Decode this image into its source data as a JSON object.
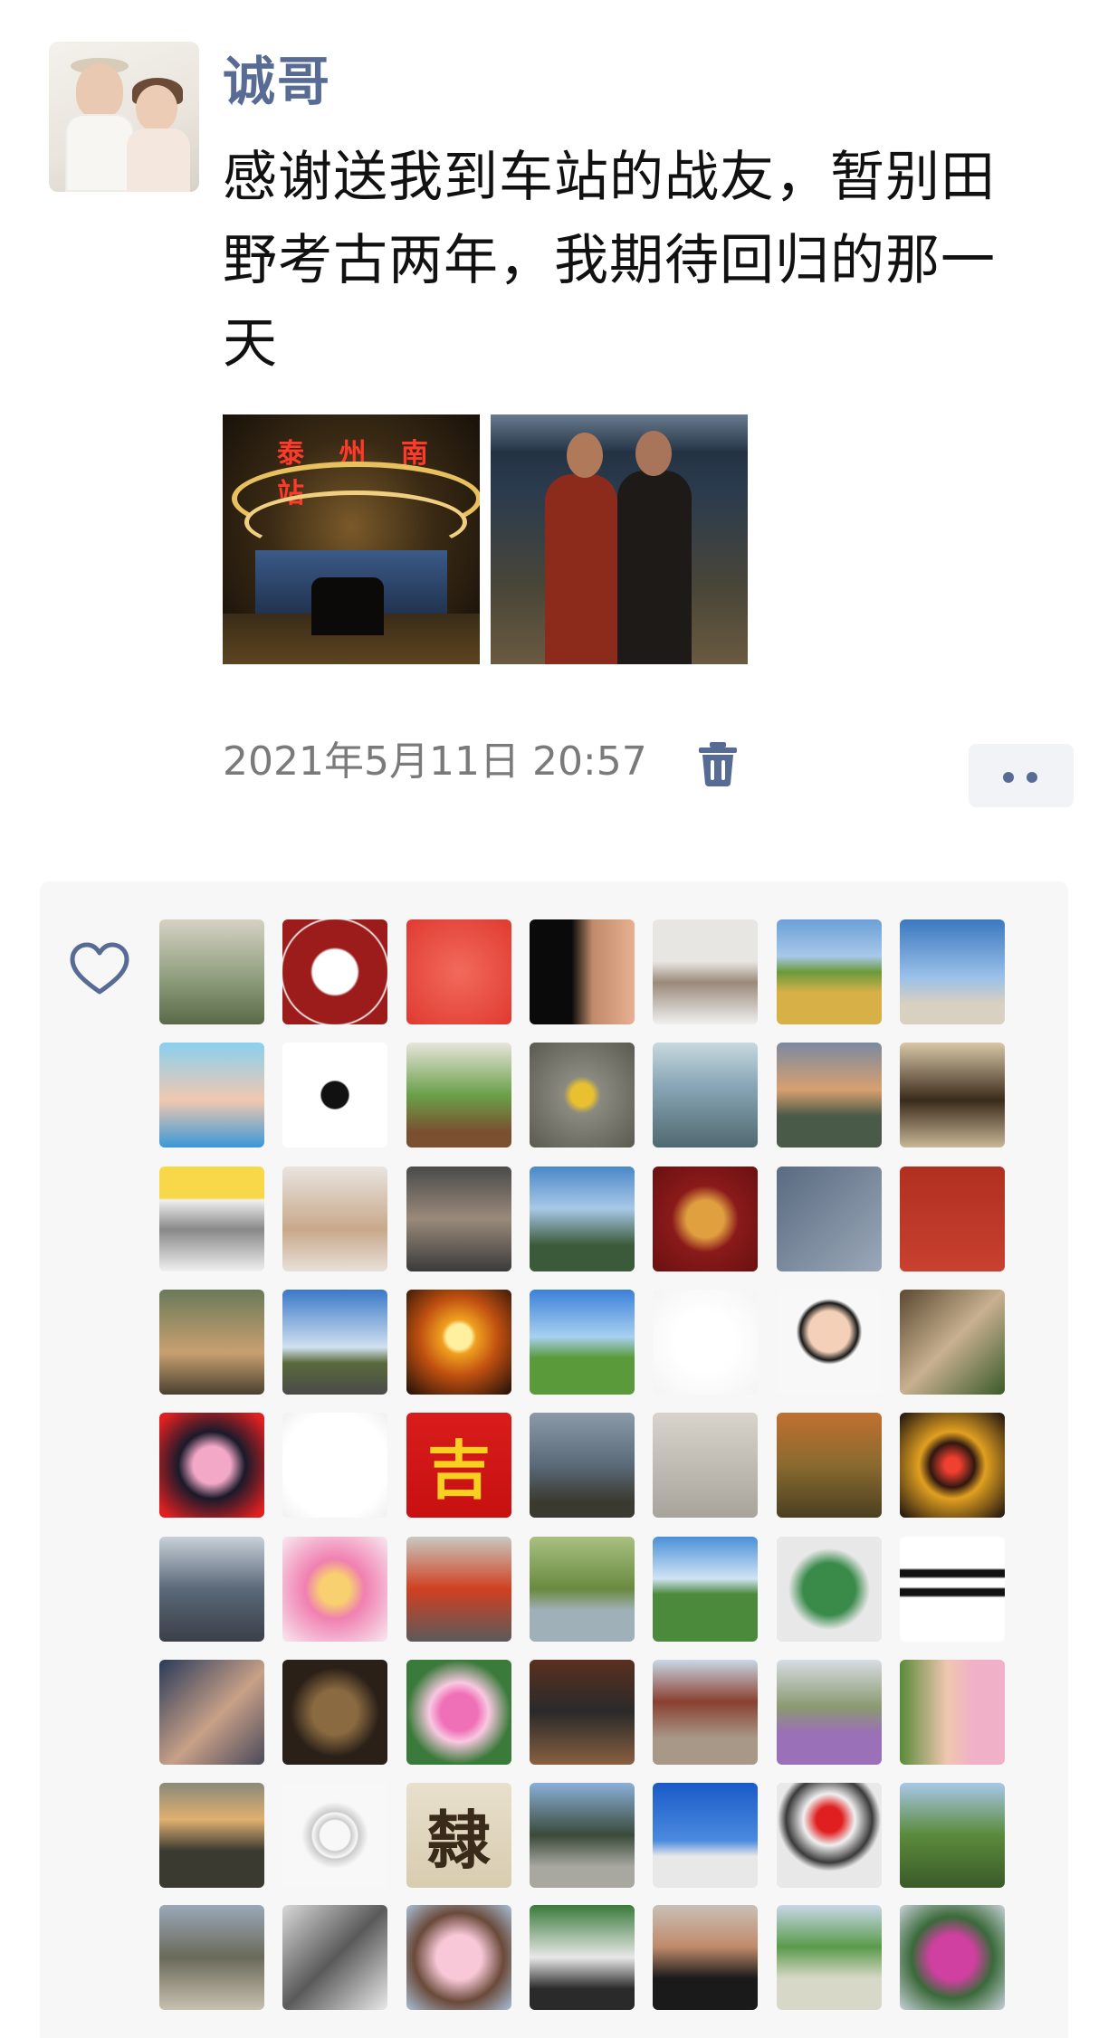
{
  "post": {
    "username": "诚哥",
    "text": "感谢送我到车站的战友，暂别田野考古两年，我期待回归的那一天",
    "photo1_sign": "泰 州 南 站",
    "timestamp": "2021年5月11日 20:57"
  },
  "likes": {
    "avatars": [
      {
        "name": "landscape-painting",
        "bg": "linear-gradient(180deg,#d6d2c4,#8a9a78 60%,#5a6a4a)"
      },
      {
        "name": "peking-university-logo",
        "bg": "radial-gradient(circle,#ffffff 30%,#9c1c1c 33%,#9c1c1c 70%,#ffffff 72%,#9c1c1c 74%)"
      },
      {
        "name": "red-square",
        "bg": "radial-gradient(circle,#f26a5c,#e03a30)"
      },
      {
        "name": "baby-photo",
        "bg": "linear-gradient(90deg,#0a0a0a 40%,#c08a6a 60%,#e8b090)"
      },
      {
        "name": "man-portrait",
        "bg": "linear-gradient(180deg,#e8e6e2 40%,#9a8a7a 60%,#f0f0f0)"
      },
      {
        "name": "wheat-field",
        "bg": "linear-gradient(180deg,#6aa0d8 0%,#a8c8e8 35%,#6a9a3a 50%,#d8b048 70%)"
      },
      {
        "name": "beach-person",
        "bg": "linear-gradient(180deg,#3a78c0 0%,#9ac0e8 55%,#d8d0c0 80%)"
      },
      {
        "name": "girl-camera",
        "bg": "linear-gradient(180deg,#8ad0f0,#f0c8b0 55%,#3a98d8)"
      },
      {
        "name": "jumpman-logo",
        "bg": "radial-gradient(circle at 50% 50%,#111 18%,#fff 20%)"
      },
      {
        "name": "bamboo-plant",
        "bg": "linear-gradient(180deg,#e8e4dc,#6aa048 50%,#7a5030 85%)"
      },
      {
        "name": "leaf-heart",
        "bg": "radial-gradient(circle,#e8c030 15%,#8a8a80 25%,#5a5a50)"
      },
      {
        "name": "lake-ducks",
        "bg": "linear-gradient(180deg,#c8d8e0,#8aa8b8 40%,#506870)"
      },
      {
        "name": "sunset-hills",
        "bg": "linear-gradient(180deg,#7a8aa0,#d8a070 45%,#4a5a48 70%)"
      },
      {
        "name": "bronze-vessel",
        "bg": "linear-gradient(180deg,#d8c8a8,#3a2a1a 55%,#c8b898)"
      },
      {
        "name": "cat-cartoon",
        "bg": "linear-gradient(180deg,#f8d848 30%,#f0f0f0 32%,#888 60%,#f0f0f0)"
      },
      {
        "name": "toddler-photo",
        "bg": "linear-gradient(180deg,#e8e4e0,#c8a88a 60%,#e8e0d8)"
      },
      {
        "name": "baby-sofa",
        "bg": "linear-gradient(180deg,#4a4a4a,#9a8a7a 50%,#3a3a3a)"
      },
      {
        "name": "mountain-sky",
        "bg": "linear-gradient(180deg,#4a88c8,#a8c8e8 40%,#3a5a3a 75%)"
      },
      {
        "name": "crest-emblem",
        "bg": "radial-gradient(circle,#e0a040 25%,#8a1a1a 45%,#6a1010)"
      },
      {
        "name": "praying-hands",
        "bg": "linear-gradient(135deg,#5a6a80,#9aa8b8)"
      },
      {
        "name": "calligraphy-seal",
        "bg": "linear-gradient(180deg,#b03020,#c84030)"
      },
      {
        "name": "kitten-photo",
        "bg": "linear-gradient(180deg,#6a7a5a,#c8a070 60%,#4a4030)"
      },
      {
        "name": "road-sky",
        "bg": "linear-gradient(180deg,#3a78c8,#d0e0f0 55%,#5a6a3a 70%,#4a4a4a)"
      },
      {
        "name": "sunset-sun",
        "bg": "radial-gradient(circle at 50% 45%,#fff0a0 16%,#f0a020 22%,#c05010 50%,#201008)"
      },
      {
        "name": "horse-rider",
        "bg": "linear-gradient(180deg,#3a80d8,#a8d0f0 45%,#5a9a3a 65%)"
      },
      {
        "name": "smiley-sketch",
        "bg": "radial-gradient(circle,#ffffff 40%,#f4f4f4)"
      },
      {
        "name": "cartoon-boy",
        "bg": "radial-gradient(circle at 50% 40%,#f4d0b8 25%,#1a1a1a 35%,#f8f8f8 40%)"
      },
      {
        "name": "raccoon-photo",
        "bg": "linear-gradient(135deg,#5a4a30,#c8b090 50%,#3a5a2a)"
      },
      {
        "name": "peppa-pig",
        "bg": "radial-gradient(circle,#f4a8c8 25%,#1a1a2a 45%,#e02020 90%)"
      },
      {
        "name": "yoga-symbol",
        "bg": "radial-gradient(circle,#ffffff 70%,#f0f0f0)"
      },
      {
        "name": "ji-character",
        "bg": "linear-gradient(180deg,#d81c1c,#c81010)",
        "glyph": "吉"
      },
      {
        "name": "rock-formation",
        "bg": "linear-gradient(180deg,#8a9aa8,#5a6a78 50%,#3a3a30 85%)"
      },
      {
        "name": "ancient-text",
        "bg": "linear-gradient(180deg,#d8d4cc,#a8a49c)"
      },
      {
        "name": "river-cliff",
        "bg": "linear-gradient(180deg,#c07030,#8a6a30 50%,#4a4020)"
      },
      {
        "name": "lanterns",
        "bg": "radial-gradient(circle,#f04030 10%,#301810 30%,#e0a020 45%,#1a1010)"
      },
      {
        "name": "city-building",
        "bg": "linear-gradient(180deg,#c8d0d8,#5a6878 50%,#3a4048)"
      },
      {
        "name": "cartoon-girl",
        "bg": "radial-gradient(circle,#f8d070 20%,#f080b0 40%,#f8e8f0)"
      },
      {
        "name": "kids-photo",
        "bg": "linear-gradient(180deg,#c8c8c0,#d04020 50%,#5a5a5a)"
      },
      {
        "name": "willow-pond",
        "bg": "linear-gradient(180deg,#a8c080,#6a8a40 50%,#a0b0b8 70%)"
      },
      {
        "name": "grassland",
        "bg": "linear-gradient(180deg,#4a90d8,#d0e4f4 40%,#4a8a3a 55%)"
      },
      {
        "name": "jade-statue",
        "bg": "radial-gradient(circle,#3a8a4a 35%,#e8e8e8 55%)"
      },
      {
        "name": "logo-lines",
        "bg": "linear-gradient(180deg,#fff 30%,#111 32%,#111 38%,#fff 40%,#fff 48%,#111 50%,#111 56%,#fff 58%)"
      },
      {
        "name": "sleeping-man",
        "bg": "linear-gradient(135deg,#2a3a5a,#c8a088 55%,#4a4a5a)"
      },
      {
        "name": "tomb-figure",
        "bg": "radial-gradient(circle,#8a6a40 30%,#2a2018 60%)"
      },
      {
        "name": "lotus-flower",
        "bg": "radial-gradient(circle,#f070b8 25%,#f8c8e0 40%,#3a7a3a 70%)"
      },
      {
        "name": "man-sitting",
        "bg": "linear-gradient(180deg,#5a3020,#2a2a2a 50%,#8a6040)"
      },
      {
        "name": "temple-courtyard",
        "bg": "linear-gradient(180deg,#c8d8e8,#8a4030 40%,#a89888 75%)"
      },
      {
        "name": "lavender-field",
        "bg": "linear-gradient(180deg,#d8dce4,#8a9a70 45%,#9a70b8 70%)"
      },
      {
        "name": "woman-smiling",
        "bg": "linear-gradient(90deg,#5a8a3a,#f0c8b0 45%,#f0b0c8 70%)"
      },
      {
        "name": "sunset-mountains",
        "bg": "linear-gradient(180deg,#8a8a7a,#e0b070 35%,#3a3a30 65%)"
      },
      {
        "name": "mandala-sketch",
        "bg": "radial-gradient(circle,#f8f8f8 20%,#cccccc 22%,#f8f8f8 30%,#cccccc 32%,#f8f8f8 45%)"
      },
      {
        "name": "seal-script",
        "bg": "linear-gradient(180deg,#e8e0cc,#d8ccb0)",
        "glyph": "隸"
      },
      {
        "name": "ancient-gate",
        "bg": "linear-gradient(180deg,#8ab0d8,#3a4a3a 50%,#a8a8a0 80%)"
      },
      {
        "name": "eagle-sky",
        "bg": "linear-gradient(180deg,#1a5ac8,#4a8ae0 55%,#e8e8e8 70%)"
      },
      {
        "name": "dog-santa-hat",
        "bg": "radial-gradient(circle at 50% 35%,#e02020 15%,#f0f0f0 30%,#3a3a3a 50%,#e8e8e8 60%)"
      },
      {
        "name": "fence-field",
        "bg": "linear-gradient(180deg,#a8c8e8,#5a8a3a 50%,#3a5a2a)"
      },
      {
        "name": "woman-path",
        "bg": "linear-gradient(180deg,#9aa8b8,#6a6a5a 50%,#c8c0b0)"
      },
      {
        "name": "power-tower",
        "bg": "linear-gradient(135deg,#d8d8d8,#5a5a5a 50%,#e8e8e8)"
      },
      {
        "name": "cherry-blossom",
        "bg": "radial-gradient(circle,#f8c8d8 30%,#6a4a3a 60%,#a8c0d8)"
      },
      {
        "name": "potted-plant",
        "bg": "linear-gradient(180deg,#3a7a3a,#e8e8e8 50%,#2a2a2a 80%)"
      },
      {
        "name": "man-suit",
        "bg": "linear-gradient(180deg,#c8c0b8,#c08a6a 40%,#1a1a1a 70%)"
      },
      {
        "name": "park-aerial",
        "bg": "linear-gradient(180deg,#c8d8e8,#5a9a4a 40%,#d8d8c8 70%)"
      },
      {
        "name": "bougainvillea",
        "bg": "radial-gradient(circle,#d040a0 30%,#3a6a3a 55%,#c8d0d8)"
      }
    ]
  }
}
